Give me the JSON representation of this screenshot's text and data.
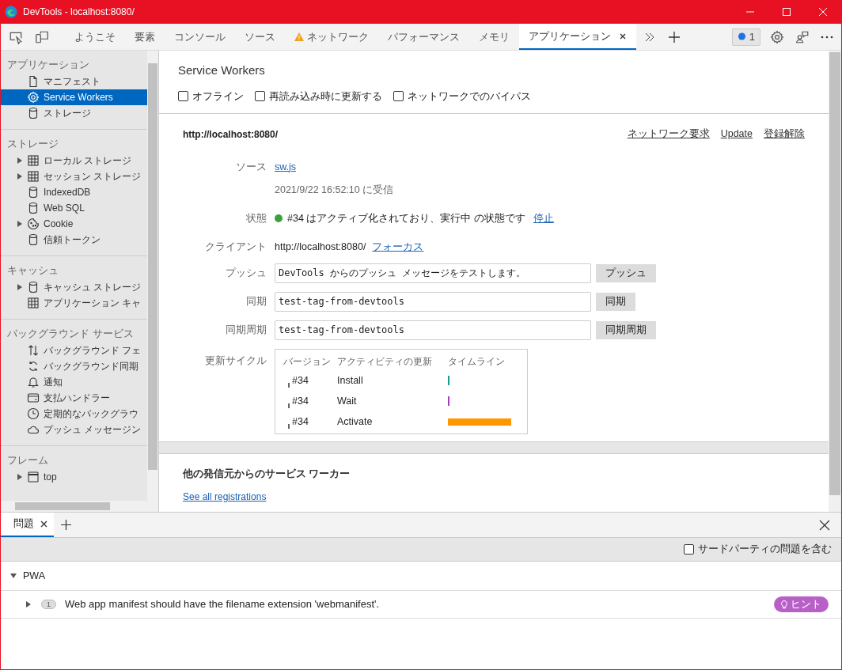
{
  "window": {
    "title": "DevTools - localhost:8080/"
  },
  "tabs": [
    {
      "label": "ようこそ",
      "selected": false,
      "warning": false
    },
    {
      "label": "要素",
      "selected": false,
      "warning": false
    },
    {
      "label": "コンソール",
      "selected": false,
      "warning": false
    },
    {
      "label": "ソース",
      "selected": false,
      "warning": false
    },
    {
      "label": "ネットワーク",
      "selected": false,
      "warning": true
    },
    {
      "label": "パフォーマンス",
      "selected": false,
      "warning": false
    },
    {
      "label": "メモリ",
      "selected": false,
      "warning": false
    },
    {
      "label": "アプリケーション",
      "selected": true,
      "warning": false
    }
  ],
  "issues_badge": "1",
  "sidebar": {
    "sections": [
      {
        "title": "アプリケーション",
        "items": [
          {
            "label": "マニフェスト",
            "kind": "file",
            "expander": false,
            "selected": false
          },
          {
            "label": "Service Workers",
            "kind": "gear",
            "expander": false,
            "selected": true
          },
          {
            "label": "ストレージ",
            "kind": "db",
            "expander": false,
            "selected": false
          }
        ]
      },
      {
        "title": "ストレージ",
        "items": [
          {
            "label": "ローカル ストレージ",
            "kind": "grid",
            "expander": true,
            "selected": false
          },
          {
            "label": "セッション ストレージ",
            "kind": "grid",
            "expander": true,
            "selected": false
          },
          {
            "label": "IndexedDB",
            "kind": "db",
            "expander": false,
            "selected": false
          },
          {
            "label": "Web SQL",
            "kind": "db",
            "expander": false,
            "selected": false
          },
          {
            "label": "Cookie",
            "kind": "cookie",
            "expander": true,
            "selected": false
          },
          {
            "label": "信頼トークン",
            "kind": "db",
            "expander": false,
            "selected": false
          }
        ]
      },
      {
        "title": "キャッシュ",
        "items": [
          {
            "label": "キャッシュ ストレージ",
            "kind": "db",
            "expander": true,
            "selected": false
          },
          {
            "label": "アプリケーション キャ",
            "kind": "grid",
            "expander": false,
            "selected": false
          }
        ]
      },
      {
        "title": "バックグラウンド サービス",
        "items": [
          {
            "label": "バックグラウンド フェ",
            "kind": "arrows",
            "expander": false,
            "selected": false
          },
          {
            "label": "バックグラウンド同期",
            "kind": "sync",
            "expander": false,
            "selected": false
          },
          {
            "label": "通知",
            "kind": "bell",
            "expander": false,
            "selected": false
          },
          {
            "label": "支払ハンドラー",
            "kind": "card",
            "expander": false,
            "selected": false
          },
          {
            "label": "定期的なバックグラウ",
            "kind": "clock",
            "expander": false,
            "selected": false
          },
          {
            "label": "プッシュ メッセージン",
            "kind": "cloud",
            "expander": false,
            "selected": false
          }
        ]
      },
      {
        "title": "フレーム",
        "items": [
          {
            "label": "top",
            "kind": "frame",
            "expander": true,
            "selected": false
          }
        ]
      }
    ]
  },
  "panel": {
    "title": "Service Workers",
    "options": [
      {
        "label": "オフライン",
        "checked": false
      },
      {
        "label": "再読み込み時に更新する",
        "checked": false
      },
      {
        "label": "ネットワークでのバイパス",
        "checked": false
      }
    ],
    "origin": "http://localhost:8080/",
    "actions": [
      "ネットワーク要求",
      "Update",
      "登録解除"
    ],
    "source_label": "ソース",
    "source_link": "sw.js",
    "received": "2021/9/22 16:52:10 に受信",
    "status": {
      "label": "状態",
      "text": "#34 はアクティブ化されており、実行中 の状態です",
      "color": "#3ca03c",
      "link": "停止"
    },
    "client_label": "クライアント",
    "client_url": "http://localhost:8080/",
    "client_link": "フォーカス",
    "fields": [
      {
        "label": "プッシュ",
        "value": "DevTools からのプッシュ メッセージをテストします。",
        "button": "プッシュ"
      },
      {
        "label": "同期",
        "value": "test-tag-from-devtools",
        "button": "同期"
      },
      {
        "label": "同期周期",
        "value": "test-tag-from-devtools",
        "button": "同期周期"
      }
    ],
    "cycle_label": "更新サイクル",
    "cycle_columns": [
      "バージョン",
      "アクティビティの更新",
      "タイムライン"
    ],
    "cycle_rows": [
      {
        "version": "#34",
        "activity": "Install",
        "kind": "tick",
        "color": "#1a9c8c"
      },
      {
        "version": "#34",
        "activity": "Wait",
        "kind": "tick",
        "color": "#a040c0"
      },
      {
        "version": "#34",
        "activity": "Activate",
        "kind": "bar",
        "color": "#ff9800"
      }
    ],
    "other_title": "他の発信元からのサービス ワーカー",
    "other_link": "See all registrations"
  },
  "drawer": {
    "tabs": [
      {
        "label": "問題",
        "selected": true
      }
    ],
    "third_party": {
      "label": "サードパーティの問題を含む",
      "checked": false
    },
    "groups": [
      {
        "title": "PWA",
        "expanded": true,
        "issues": [
          {
            "count": "1",
            "text": "Web app manifest should have the filename extension 'webmanifest'.",
            "tag": "ヒント"
          }
        ]
      }
    ]
  }
}
